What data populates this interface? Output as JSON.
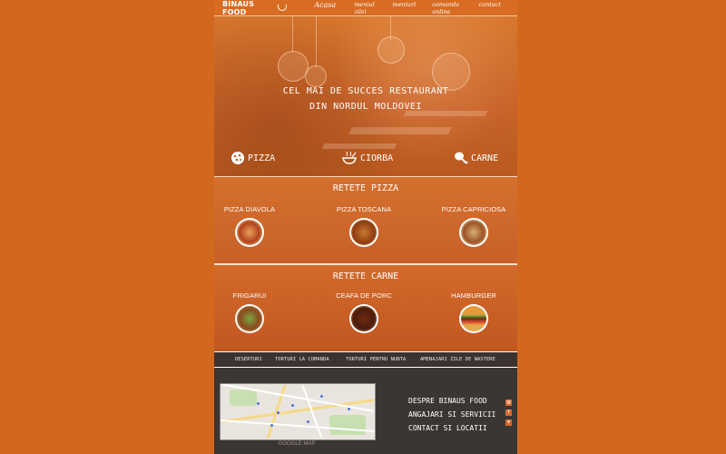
{
  "header": {
    "brand": "BINAUS FOOD",
    "nav": [
      "Acasa",
      "meniul zilei",
      "meniuri",
      "comanda online",
      "contact"
    ]
  },
  "hero": {
    "title_line1": "CEL MAI DE SUCCES RESTAURANT",
    "title_line2": "DIN NORDUL MOLDOVEI",
    "categories": [
      "PIZZA",
      "CIORBA",
      "CARNE"
    ]
  },
  "pizza_section": {
    "title": "RETETE PIZZA",
    "items": [
      "PIZZA DIAVOLA",
      "PIZZA TOSCANA",
      "PIZZA CAPRICIOSA"
    ]
  },
  "carne_section": {
    "title": "RETETE CARNE",
    "items": [
      "FRIGARUI",
      "CEAFA DE PORC",
      "HAMBURGER"
    ]
  },
  "dessert_bar": {
    "links": [
      "DESERTURI",
      "TORTURI LA COMANDA",
      "TORTURI PENTRU NUNTA",
      "AMENAJARI ZILE DE NASTERE"
    ]
  },
  "footer": {
    "map_caption": "GOOGLE MAP",
    "links": [
      "DESPRE BINAUS FOOD",
      "ANGAJARI SI SERVICII",
      "CONTACT SI LOCATII"
    ],
    "social_icons": [
      "instagram-icon",
      "facebook-icon",
      "twitter-icon"
    ]
  },
  "colors": {
    "background": "#d2681e",
    "page": "#c9601c",
    "footer": "#3b3634",
    "accent": "#d8692a"
  }
}
